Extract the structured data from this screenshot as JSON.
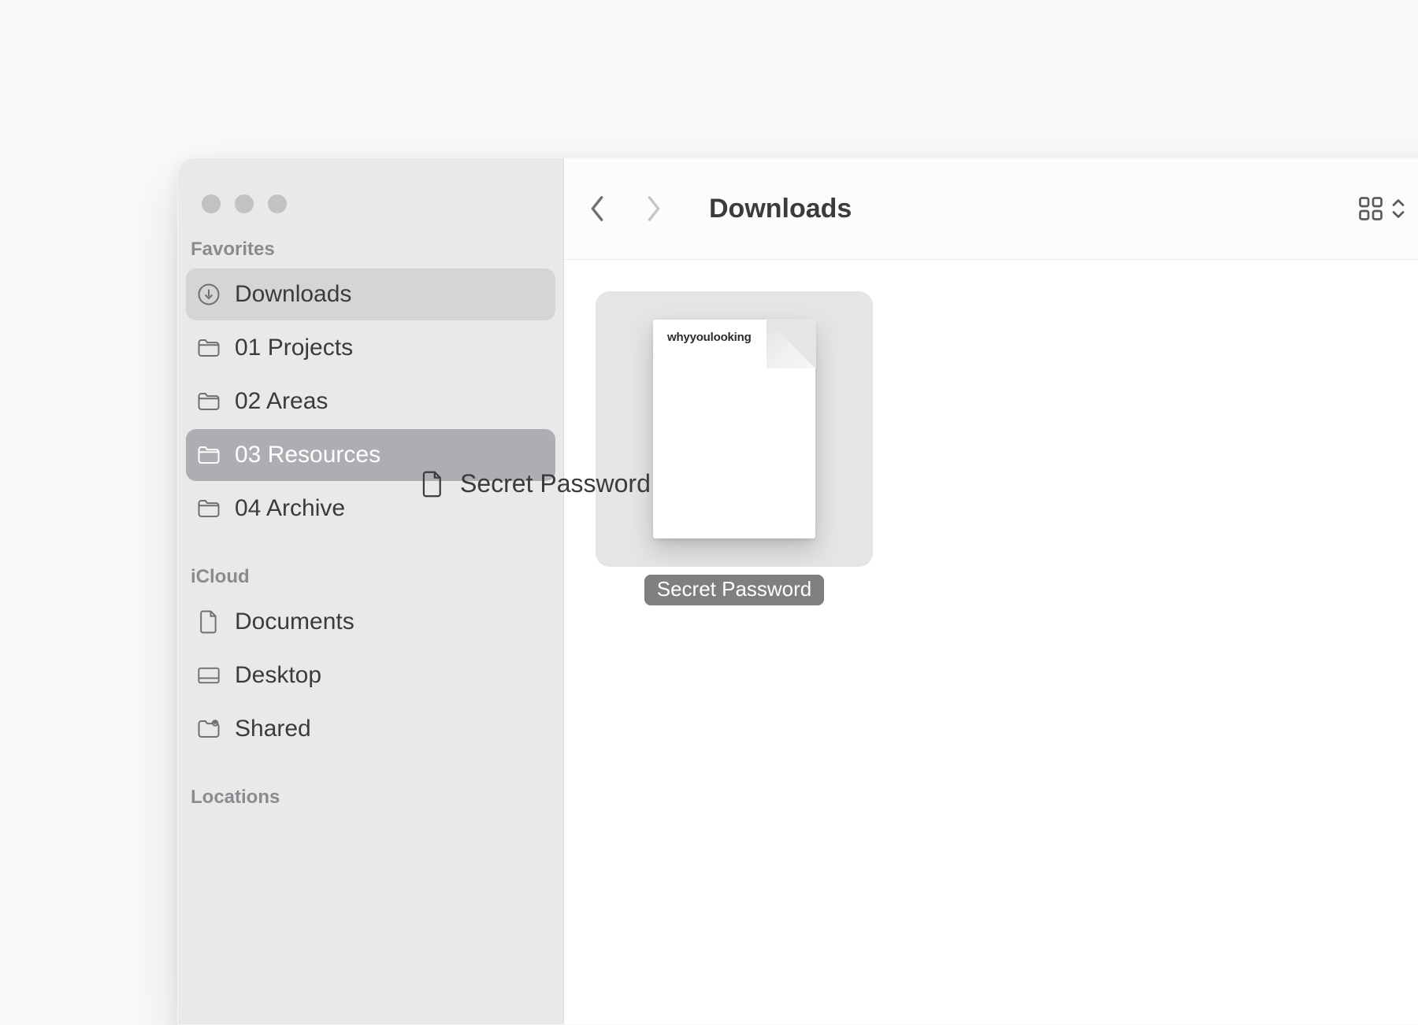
{
  "window": {
    "title": "Downloads"
  },
  "sidebar": {
    "sections": {
      "favorites": {
        "title": "Favorites",
        "items": [
          {
            "label": "Downloads"
          },
          {
            "label": "01 Projects"
          },
          {
            "label": "02 Areas"
          },
          {
            "label": "03 Resources"
          },
          {
            "label": "04 Archive"
          }
        ]
      },
      "icloud": {
        "title": "iCloud",
        "items": [
          {
            "label": "Documents"
          },
          {
            "label": "Desktop"
          },
          {
            "label": "Shared"
          }
        ]
      },
      "locations": {
        "title": "Locations",
        "items": []
      }
    }
  },
  "files": [
    {
      "name": "Secret Password",
      "preview_text": "whyyoulooking"
    }
  ],
  "drag_ghost": {
    "label": "Secret Password"
  }
}
